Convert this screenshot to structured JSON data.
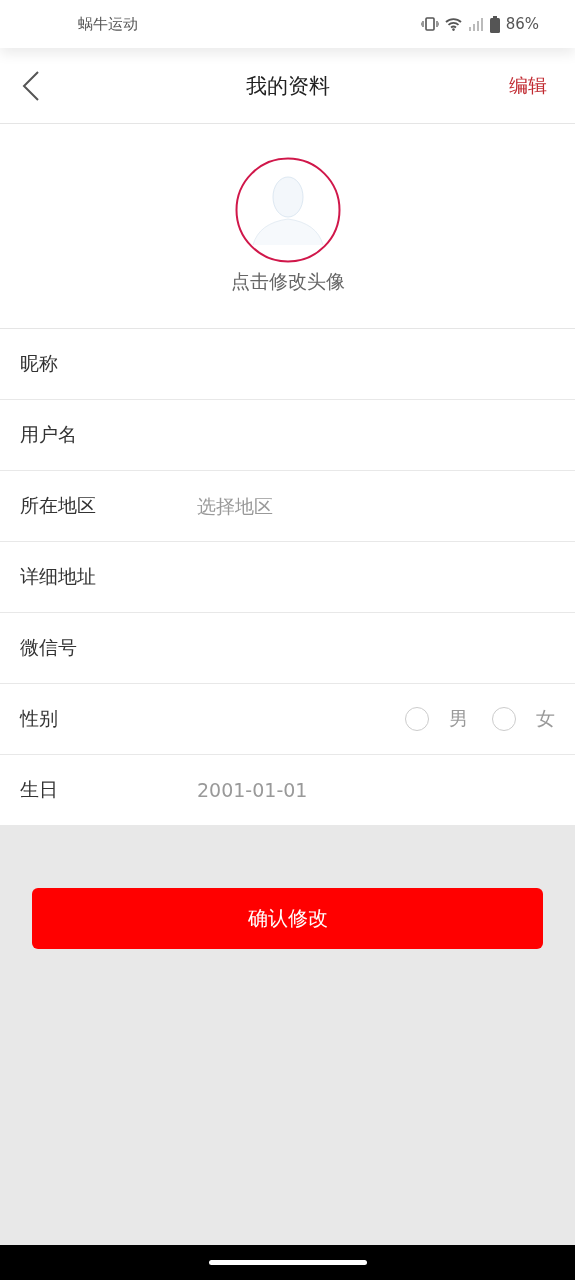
{
  "status_bar": {
    "app_name": "蜗牛运动",
    "battery_text": "86%"
  },
  "header": {
    "title": "我的资料",
    "action": "编辑"
  },
  "avatar": {
    "caption": "点击修改头像"
  },
  "fields": [
    {
      "kind": "input",
      "label": "昵称"
    },
    {
      "kind": "input",
      "label": "用户名"
    },
    {
      "kind": "select",
      "label": "所在地区",
      "placeholder": "选择地区"
    },
    {
      "kind": "input",
      "label": "详细地址"
    },
    {
      "kind": "input",
      "label": "微信号"
    },
    {
      "kind": "radio",
      "label": "性别",
      "options": [
        {
          "label": "男",
          "selected": false
        },
        {
          "label": "女",
          "selected": false
        }
      ]
    },
    {
      "kind": "date",
      "label": "生日",
      "value": "2001-01-01"
    }
  ],
  "submit_button": "确认修改"
}
